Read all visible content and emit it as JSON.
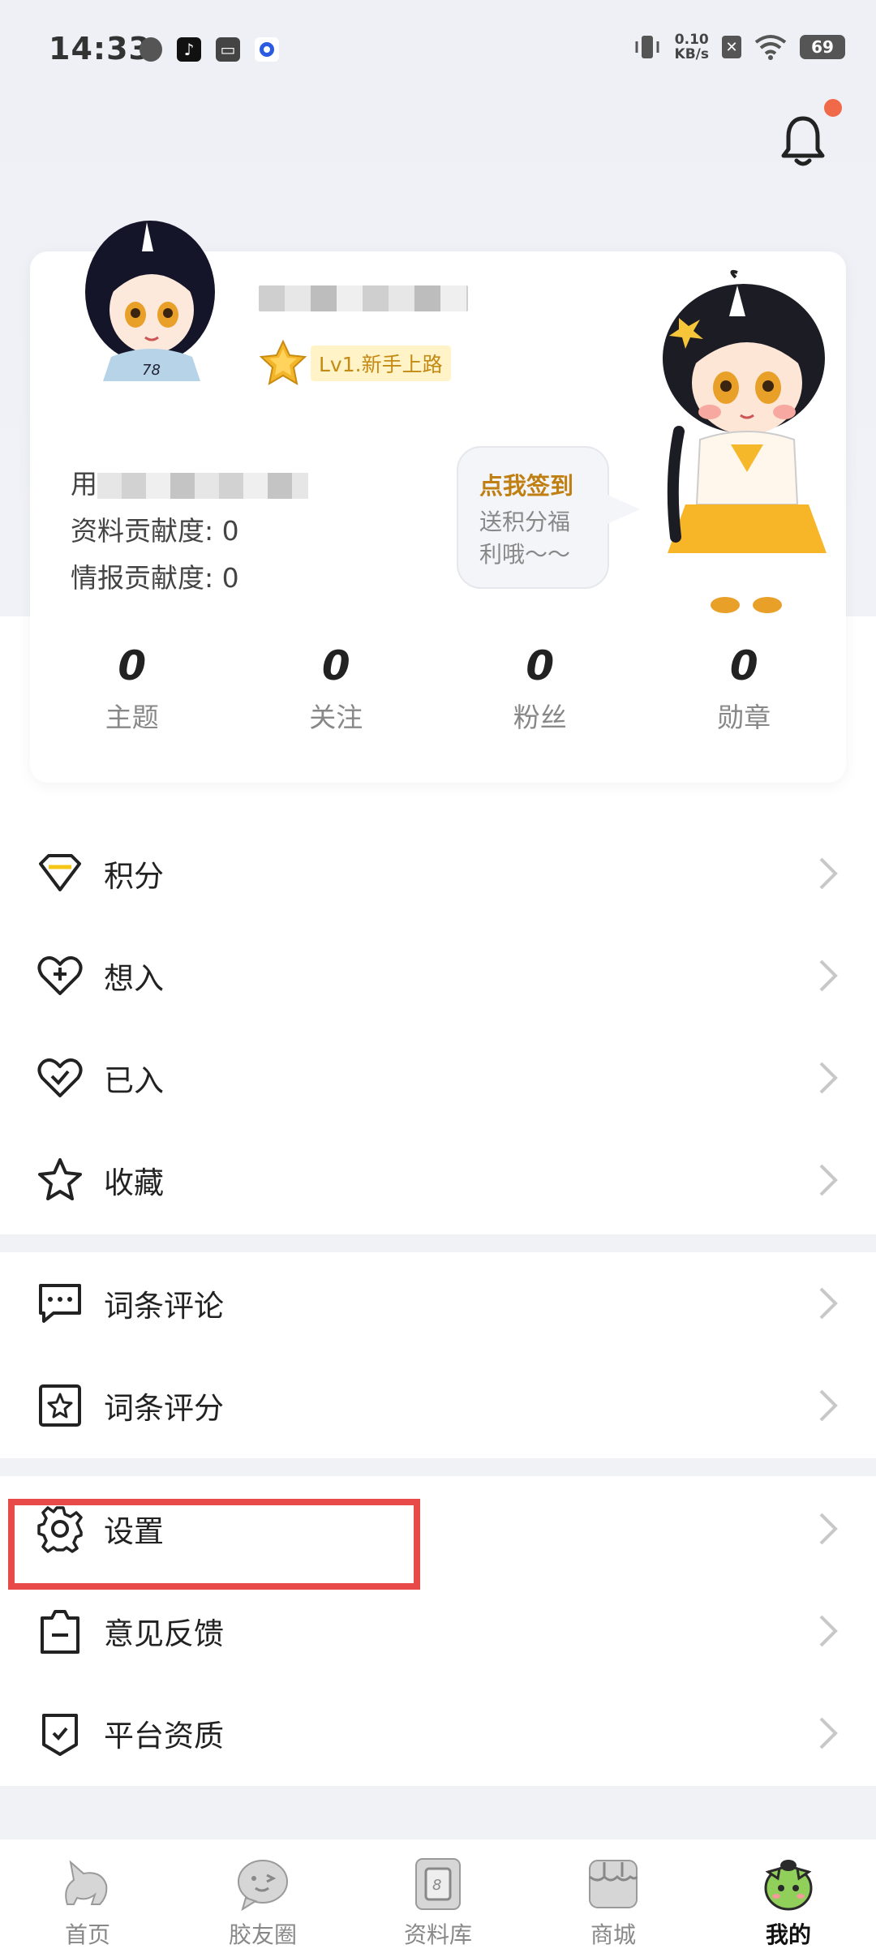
{
  "status_bar": {
    "time": "14:33",
    "net_speed_value": "0.10",
    "net_speed_unit": "KB/s",
    "battery": "69"
  },
  "profile": {
    "level": "Lv1.新手上路",
    "uid_prefix": "用",
    "data_contribution": "资料贡献度: 0",
    "intel_contribution": "情报贡献度: 0",
    "checkin_title": "点我签到",
    "checkin_sub_line1": "送积分福",
    "checkin_sub_line2": "利哦～～",
    "stats": [
      {
        "value": "0",
        "label": "主题"
      },
      {
        "value": "0",
        "label": "关注"
      },
      {
        "value": "0",
        "label": "粉丝"
      },
      {
        "value": "0",
        "label": "勋章"
      }
    ]
  },
  "menu": {
    "points": "积分",
    "want": "想入",
    "owned": "已入",
    "favorites": "收藏",
    "entry_comments": "词条评论",
    "entry_ratings": "词条评分",
    "settings": "设置",
    "feedback": "意见反馈",
    "platform_qualification": "平台资质"
  },
  "tabs": [
    {
      "label": "首页",
      "icon": "home-unicorn-icon"
    },
    {
      "label": "胶友圈",
      "icon": "chat-bubble-face-icon"
    },
    {
      "label": "资料库",
      "icon": "database-card-icon"
    },
    {
      "label": "商城",
      "icon": "shop-icon"
    },
    {
      "label": "我的",
      "icon": "profile-mascot-icon"
    }
  ],
  "colors": {
    "accent_gold": "#c07f12",
    "highlight_red": "#e84a4a",
    "notify_dot": "#f06a4a"
  }
}
